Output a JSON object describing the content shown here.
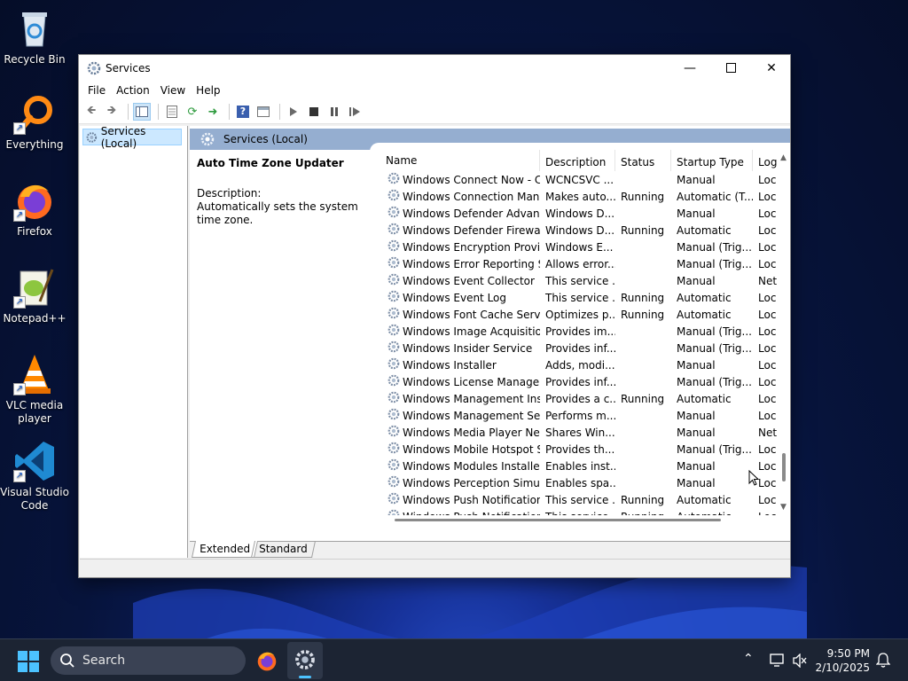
{
  "desktop": {
    "icons": [
      {
        "label": "Recycle Bin"
      },
      {
        "label": "Everything"
      },
      {
        "label": "Firefox"
      },
      {
        "label": "Notepad++"
      },
      {
        "label": "VLC media player"
      },
      {
        "label": "Visual Studio Code"
      }
    ]
  },
  "window": {
    "title": "Services",
    "menu": [
      "File",
      "Action",
      "View",
      "Help"
    ],
    "tree_item": "Services (Local)",
    "header": "Services (Local)",
    "selected_service": "Auto Time Zone Updater",
    "description_label": "Description:",
    "description_text": "Automatically sets the system time zone.",
    "columns": [
      "Name",
      "Description",
      "Status",
      "Startup Type",
      "Log"
    ],
    "rows": [
      [
        "Windows Connect Now - C...",
        "WCNCSVC ...",
        "",
        "Manual",
        "Loc"
      ],
      [
        "Windows Connection Mana...",
        "Makes auto...",
        "Running",
        "Automatic (T...",
        "Loc"
      ],
      [
        "Windows Defender Advanc...",
        "Windows D...",
        "",
        "Manual",
        "Loc"
      ],
      [
        "Windows Defender Firewall",
        "Windows D...",
        "Running",
        "Automatic",
        "Loc"
      ],
      [
        "Windows Encryption Provid...",
        "Windows E...",
        "",
        "Manual (Trig...",
        "Loc"
      ],
      [
        "Windows Error Reporting Se...",
        "Allows error...",
        "",
        "Manual (Trig...",
        "Loc"
      ],
      [
        "Windows Event Collector",
        "This service ...",
        "",
        "Manual",
        "Net"
      ],
      [
        "Windows Event Log",
        "This service ...",
        "Running",
        "Automatic",
        "Loc"
      ],
      [
        "Windows Font Cache Service",
        "Optimizes p...",
        "Running",
        "Automatic",
        "Loc"
      ],
      [
        "Windows Image Acquisitio...",
        "Provides im...",
        "",
        "Manual (Trig...",
        "Loc"
      ],
      [
        "Windows Insider Service",
        "Provides inf...",
        "",
        "Manual (Trig...",
        "Loc"
      ],
      [
        "Windows Installer",
        "Adds, modi...",
        "",
        "Manual",
        "Loc"
      ],
      [
        "Windows License Manager ...",
        "Provides inf...",
        "",
        "Manual (Trig...",
        "Loc"
      ],
      [
        "Windows Management Inst...",
        "Provides a c...",
        "Running",
        "Automatic",
        "Loc"
      ],
      [
        "Windows Management Ser...",
        "Performs m...",
        "",
        "Manual",
        "Loc"
      ],
      [
        "Windows Media Player Net...",
        "Shares Win...",
        "",
        "Manual",
        "Net"
      ],
      [
        "Windows Mobile Hotspot S...",
        "Provides th...",
        "",
        "Manual (Trig...",
        "Loc"
      ],
      [
        "Windows Modules Installer",
        "Enables inst...",
        "",
        "Manual",
        "Loc"
      ],
      [
        "Windows Perception Simul...",
        "Enables spa...",
        "",
        "Manual",
        "Loc"
      ],
      [
        "Windows Push Notification...",
        "This service ...",
        "Running",
        "Automatic",
        "Loc"
      ],
      [
        "Windows Push Notification...",
        "This service ...",
        "Running",
        "Automatic",
        "Loc"
      ]
    ],
    "tabs": [
      "Extended",
      "Standard"
    ]
  },
  "taskbar": {
    "search_label": "Search",
    "time": "9:50 PM",
    "date": "2/10/2025"
  }
}
